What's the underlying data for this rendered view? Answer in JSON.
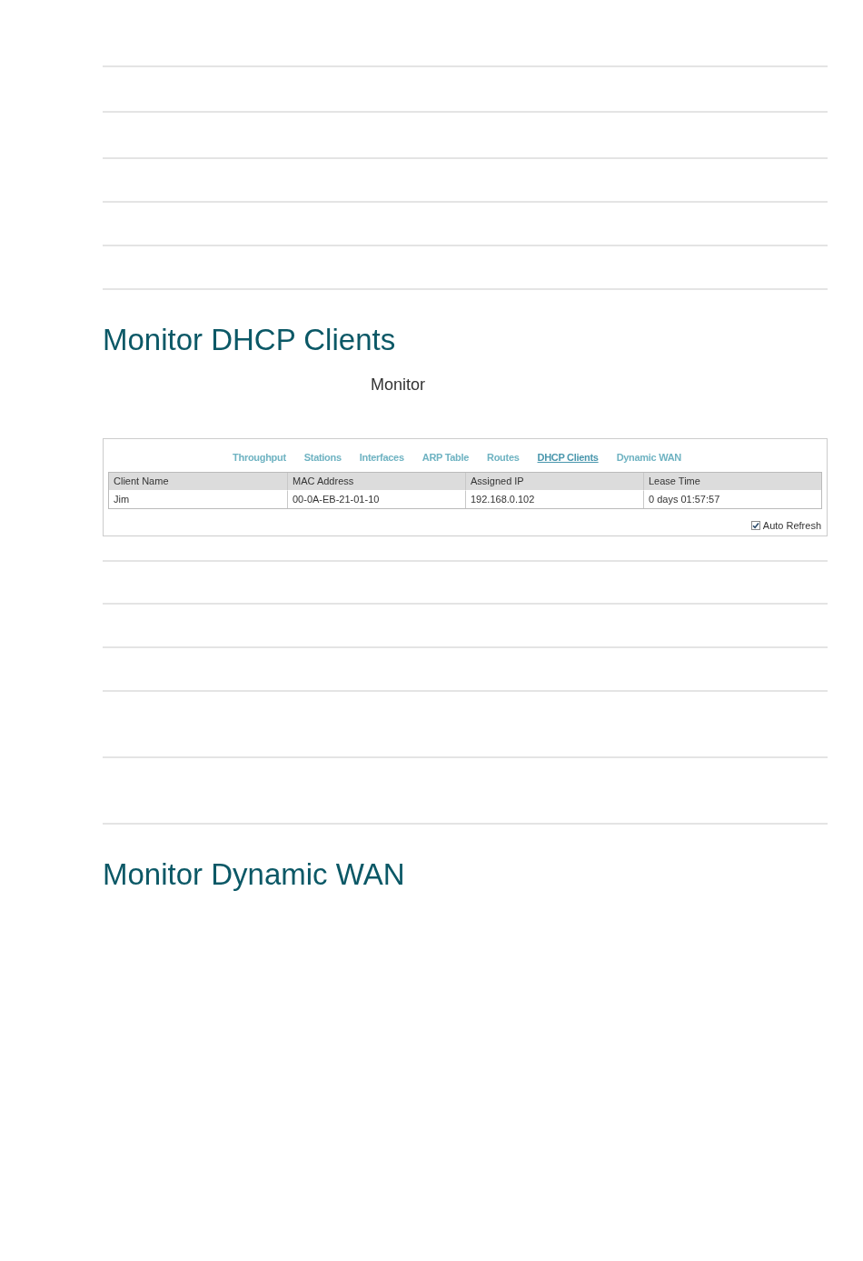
{
  "heading_dhcp": "Monitor DHCP Clients",
  "instruction_fragment": "Monitor",
  "screenshot": {
    "nav_links": [
      {
        "label": "Throughput",
        "selected": false
      },
      {
        "label": "Stations",
        "selected": false
      },
      {
        "label": "Interfaces",
        "selected": false
      },
      {
        "label": "ARP Table",
        "selected": false
      },
      {
        "label": "Routes",
        "selected": false
      },
      {
        "label": "DHCP Clients",
        "selected": true
      },
      {
        "label": "Dynamic WAN",
        "selected": false
      }
    ],
    "table": {
      "columns": [
        "Client Name",
        "MAC Address",
        "Assigned IP",
        "Lease Time"
      ],
      "rows": [
        [
          "Jim",
          "00-0A-EB-21-01-10",
          "192.168.0.102",
          "0 days 01:57:57"
        ]
      ]
    },
    "auto_refresh": {
      "label": "Auto Refresh",
      "checked": true
    }
  },
  "heading_wan": "Monitor Dynamic WAN"
}
